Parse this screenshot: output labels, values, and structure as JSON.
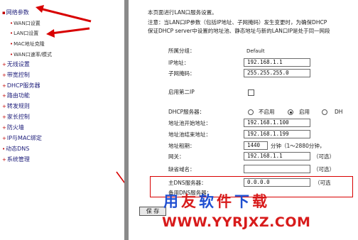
{
  "sidebar": {
    "items": [
      {
        "label": "网络参数",
        "top": 0
      },
      {
        "label": "WAN口设置",
        "sub": true
      },
      {
        "label": "LAN口设置",
        "sub": true
      },
      {
        "label": "MAC地址克隆",
        "sub": true
      },
      {
        "label": "WAN口速率/模式",
        "sub": true
      },
      {
        "label": "无线设置"
      },
      {
        "label": "带宽控制"
      },
      {
        "label": "DHCP服务器"
      },
      {
        "label": "路由功能"
      },
      {
        "label": "转发规则"
      },
      {
        "label": "家长控制"
      },
      {
        "label": "防火墙"
      },
      {
        "label": "IP与MAC绑定"
      },
      {
        "label": "动态DNS"
      },
      {
        "label": "系统管理"
      }
    ]
  },
  "intro": {
    "line1": "本页面进行LAN口服务设置。",
    "line2": "注意：当LAN口IP参数（包括IP地址、子网掩码）发生变更时，为确保DHCP",
    "line3": "保证DHCP server中设置的地址池、静态地址与新的LAN口IP是处于同一网段"
  },
  "form": {
    "group_label": "所属分组：",
    "group_value": "Default",
    "ip_label": "IP地址：",
    "ip_value": "192.168.1.1",
    "mask_label": "子网掩码：",
    "mask_value": "255.255.255.0",
    "second_ip_label": "启用第二IP",
    "dhcp_label": "DHCP服务器：",
    "dhcp_options": [
      "不启用",
      "启用",
      "DH"
    ],
    "pool_start_label": "地址池开始地址：",
    "pool_start_value": "192.168.1.100",
    "pool_end_label": "地址池结束地址：",
    "pool_end_value": "192.168.1.199",
    "lease_label": "地址租期：",
    "lease_value": "1440",
    "lease_hint": "分钟（1～2880分钟，",
    "gateway_label": "网关：",
    "gateway_value": "192.168.1.1",
    "gateway_hint": "（可选）",
    "domain_label": "缺省域名：",
    "domain_value": "",
    "domain_hint": "（可选）",
    "dns1_label": "主DNS服务器：",
    "dns1_value": "0.0.0.0",
    "dns1_hint": "（可选",
    "dns2_label": "备用DNS服务器："
  },
  "save_label": "保 存",
  "watermark": {
    "chars": [
      "用",
      "友",
      "软",
      "件",
      "下",
      "载"
    ],
    "url": "WWW.YYRJXZ.COM"
  },
  "colors": {
    "accent_red": "#d80000",
    "nav_text": "#1d1d7a",
    "frame_gray": "#8a8a8a"
  }
}
